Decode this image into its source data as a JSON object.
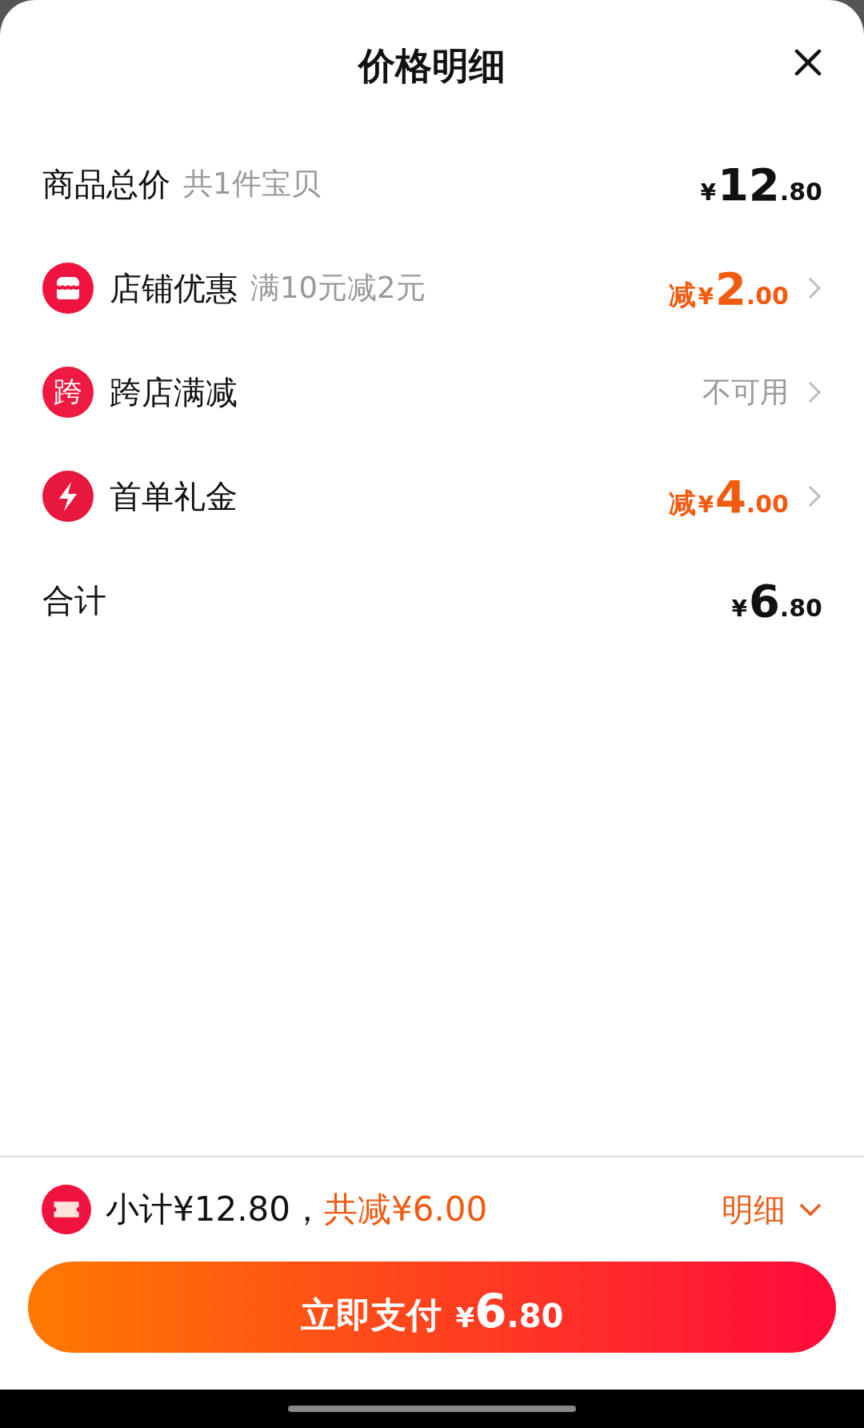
{
  "title": "价格明细",
  "rows": [
    {
      "kind": "summary",
      "label": "商品总价",
      "note": "共1件宝贝",
      "amount": {
        "currency": "¥",
        "integer": "12",
        "decimals": ".80"
      }
    },
    {
      "kind": "shop",
      "label": "店铺优惠",
      "note": "满10元减2元",
      "amount": {
        "prefix": "减",
        "currency": "¥",
        "integer": "2",
        "decimals": ".00"
      }
    },
    {
      "kind": "badge",
      "icon_text": "跨",
      "label": "跨店满减",
      "status": "不可用"
    },
    {
      "kind": "gift",
      "label": "首单礼金",
      "amount": {
        "prefix": "减",
        "currency": "¥",
        "integer": "4",
        "decimals": ".00"
      }
    },
    {
      "kind": "summary",
      "label": "合计",
      "amount": {
        "currency": "¥",
        "integer": "6",
        "decimals": ".80"
      }
    }
  ],
  "footer": {
    "subtotal": "小计¥12.80，",
    "saved": "共减¥6.00",
    "detail_link": "明细"
  },
  "pay_button": {
    "label": "立即支付",
    "currency": "¥",
    "integer": "6",
    "decimals": ".80"
  }
}
